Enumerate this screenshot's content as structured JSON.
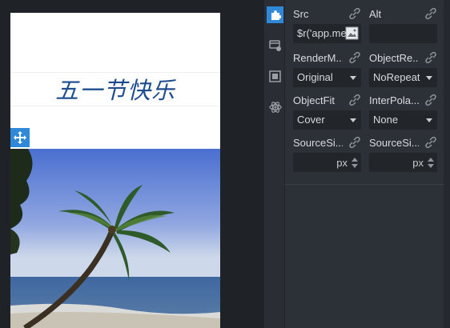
{
  "canvas": {
    "title_text": "五一节快乐"
  },
  "rail": {
    "items": [
      {
        "icon": "puzzle-icon",
        "active": true
      },
      {
        "icon": "card-icon",
        "active": false
      },
      {
        "icon": "square-icon",
        "active": false
      },
      {
        "icon": "atom-icon",
        "active": false
      }
    ]
  },
  "props": {
    "src": {
      "label": "Src",
      "value": "$r('app.me"
    },
    "alt": {
      "label": "Alt",
      "value": ""
    },
    "render_mode": {
      "label": "RenderM...",
      "value": "Original"
    },
    "object_repeat": {
      "label": "ObjectRe...",
      "value": "NoRepeat"
    },
    "object_fit": {
      "label": "ObjectFit",
      "value": "Cover"
    },
    "interpolation": {
      "label": "InterPola...",
      "value": "None"
    },
    "source_size_w": {
      "label": "SourceSi...",
      "unit": "px"
    },
    "source_size_h": {
      "label": "SourceSi...",
      "unit": "px"
    }
  },
  "colors": {
    "accent": "#2f89d8",
    "panel": "#2c3037",
    "input": "#22252a",
    "title": "#1f4c8f"
  }
}
